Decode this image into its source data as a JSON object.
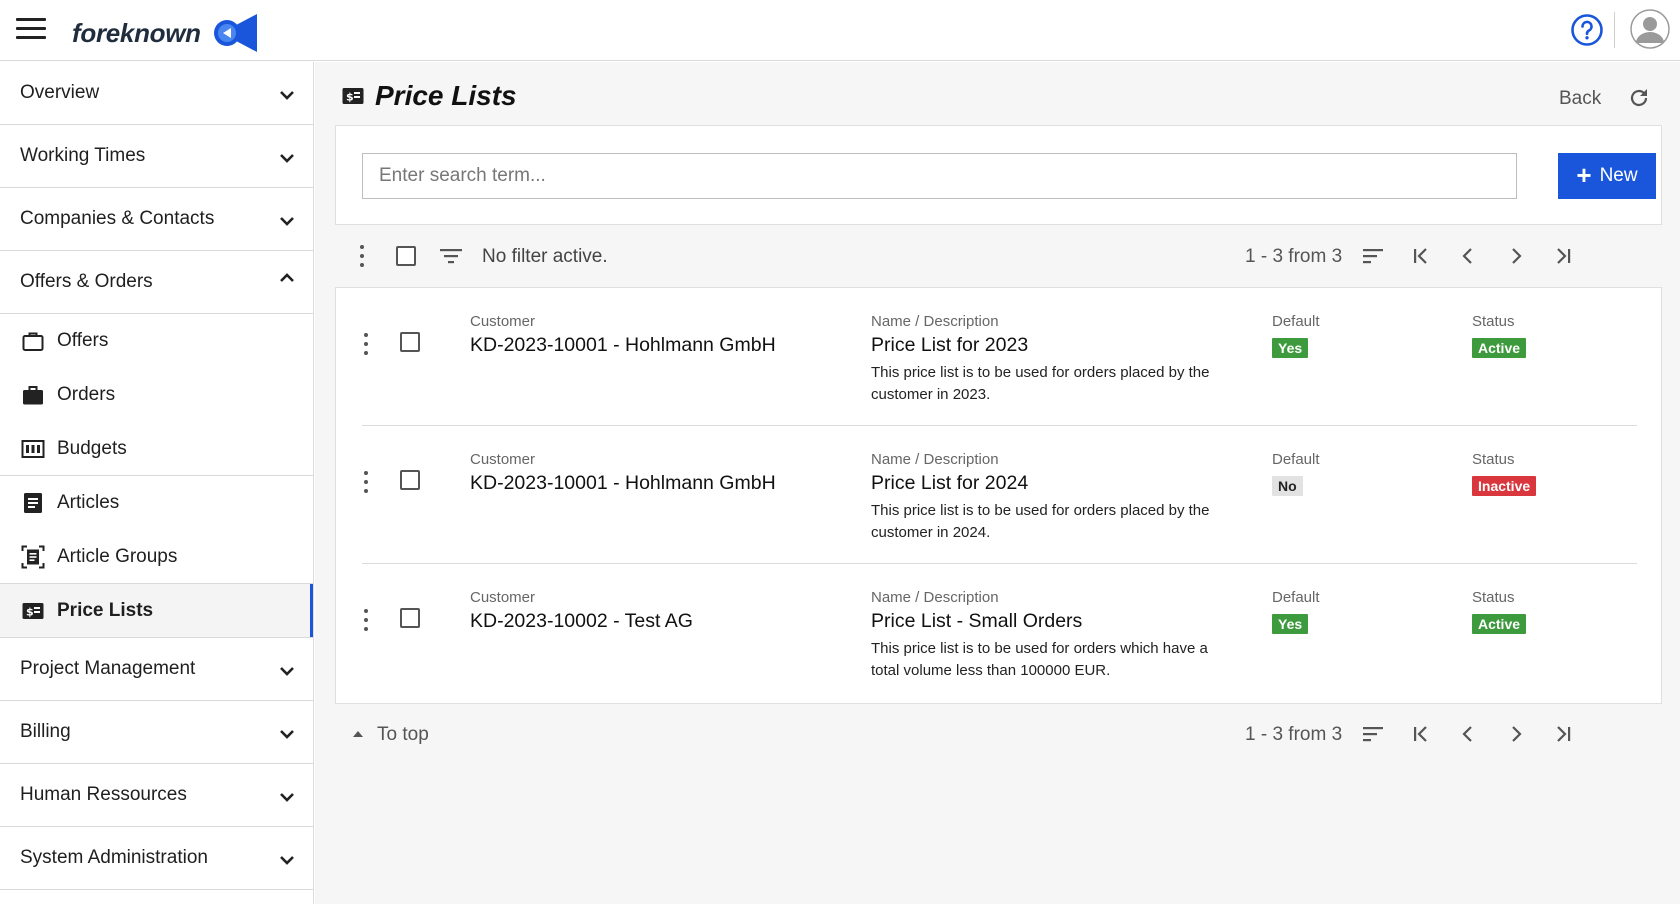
{
  "header": {
    "brand": "foreknown",
    "logo_icon": "foreknown-logo-icon",
    "help_icon": "help-icon",
    "avatar_icon": "user-avatar-icon"
  },
  "sidebar": {
    "groups_top": [
      {
        "label": "Overview",
        "icon": "chevron-down-icon"
      },
      {
        "label": "Working Times",
        "icon": "chevron-down-icon"
      },
      {
        "label": "Companies & Contacts",
        "icon": "chevron-down-icon"
      },
      {
        "label": "Offers & Orders",
        "icon": "chevron-up-icon"
      }
    ],
    "items": [
      {
        "label": "Offers",
        "icon": "briefcase-outline-icon"
      },
      {
        "label": "Orders",
        "icon": "briefcase-filled-icon"
      },
      {
        "label": "Budgets",
        "icon": "budget-icon"
      },
      {
        "label": "Articles",
        "icon": "article-icon"
      },
      {
        "label": "Article Groups",
        "icon": "article-group-icon"
      },
      {
        "label": "Price Lists",
        "icon": "price-list-icon"
      }
    ],
    "groups_bottom": [
      {
        "label": "Project Management",
        "icon": "chevron-down-icon"
      },
      {
        "label": "Billing",
        "icon": "chevron-down-icon"
      },
      {
        "label": "Human Ressources",
        "icon": "chevron-down-icon"
      },
      {
        "label": "System Administration",
        "icon": "chevron-down-icon"
      }
    ]
  },
  "page": {
    "title": "Price Lists",
    "back_label": "Back"
  },
  "search": {
    "placeholder": "Enter search term...",
    "new_label": "New"
  },
  "toolbar": {
    "filter_text": "No filter active.",
    "pager_text": "1 - 3 from 3"
  },
  "columns": {
    "customer": "Customer",
    "name": "Name / Description",
    "default": "Default",
    "status": "Status"
  },
  "rows": [
    {
      "customer": "KD-2023-10001 - Hohlmann GmbH",
      "name": "Price List for 2023",
      "description": "This price list is to be used for orders placed by the customer in 2023.",
      "default": "Yes",
      "status": "Active",
      "default_color": "#3d9a3d",
      "status_color": "#3d9a3d"
    },
    {
      "customer": "KD-2023-10001 - Hohlmann GmbH",
      "name": "Price List for 2024",
      "description": "This price list is to be used for orders placed by the customer in 2024.",
      "default": "No",
      "status": "Inactive",
      "default_color": "#e2e2e2",
      "status_color": "#d9363e"
    },
    {
      "customer": "KD-2023-10002 - Test AG",
      "name": "Price List - Small Orders",
      "description": "This price list is to be used for orders which have a total volume less than 100000 EUR.",
      "default": "Yes",
      "status": "Active",
      "default_color": "#3d9a3d",
      "status_color": "#3d9a3d"
    }
  ],
  "footer": {
    "to_top": "To top",
    "pager_text": "1 - 3 from 3"
  },
  "colors": {
    "accent": "#1a56db",
    "active_green": "#3d9a3d",
    "inactive_red": "#d9363e"
  }
}
